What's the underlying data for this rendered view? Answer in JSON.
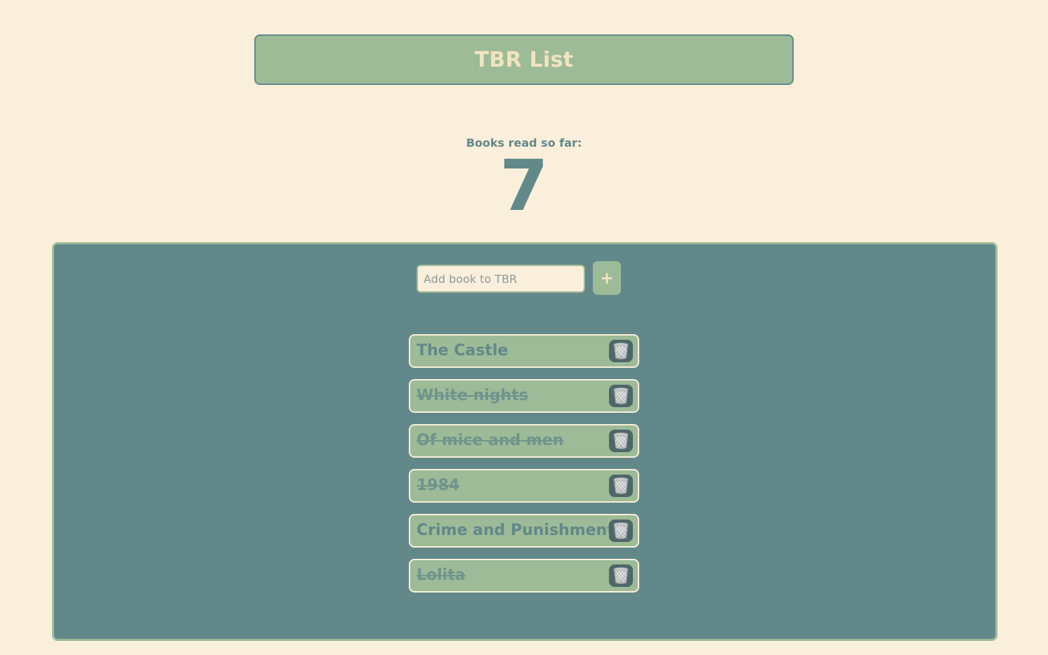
{
  "header": {
    "title": "TBR List"
  },
  "counter": {
    "label": "Books read so far:",
    "value": "7"
  },
  "add_form": {
    "placeholder": "Add book to TBR",
    "value": "",
    "button_label": "+"
  },
  "books": [
    {
      "title": "The Castle",
      "read": false
    },
    {
      "title": "White nights",
      "read": true
    },
    {
      "title": "Of mice and men",
      "read": true
    },
    {
      "title": "1984",
      "read": true
    },
    {
      "title": "Crime and Punishment",
      "read": false
    },
    {
      "title": "Lolita",
      "read": true
    }
  ],
  "icons": {
    "add": "plus-icon",
    "delete": "wastebasket-icon"
  },
  "colors": {
    "background": "#faefdb",
    "accent_green": "#9dbb97",
    "teal": "#62888a",
    "header_text": "#f1e4bf"
  }
}
